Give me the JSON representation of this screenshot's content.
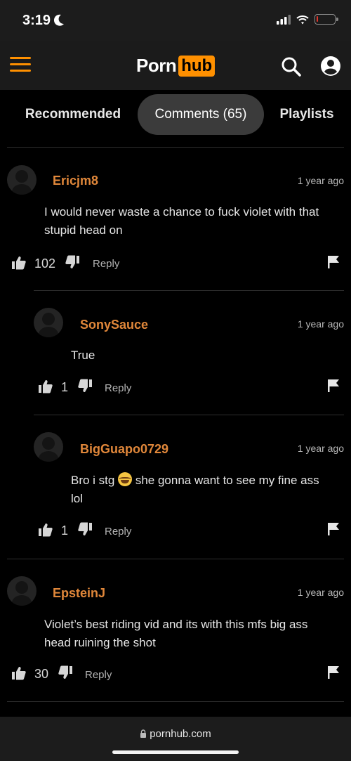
{
  "status_bar": {
    "time": "3:19",
    "battery_level": 0.1,
    "battery_color": "#e0362c"
  },
  "header": {
    "logo_left": "Porn",
    "logo_right": "hub",
    "accent": "#ff9000",
    "icons": [
      "menu-icon",
      "search-icon",
      "account-icon"
    ]
  },
  "tabs": [
    {
      "label": "Recommended",
      "active": false
    },
    {
      "label": "Comments (65)",
      "active": true
    },
    {
      "label": "Playlists",
      "active": false
    }
  ],
  "comments": [
    {
      "username": "Ericjm8",
      "time": "1 year ago",
      "text_line1": "I would never waste a chance to fuck violet with that",
      "text_line2": "stupid head on",
      "likes": "102",
      "reply_label": "Reply"
    },
    {
      "username": "SonySauce",
      "time": "1 year ago",
      "text_line1": "True",
      "likes": "1",
      "reply_label": "Reply"
    },
    {
      "username": "BigGuapo0729",
      "time": "1 year ago",
      "text_before_emoji": "Bro i stg",
      "emoji": "face-with-tears-of-joy",
      "text_after_emoji": "she gonna want to see my fine ass",
      "text_line2": "lol",
      "likes": "1",
      "reply_label": "Reply"
    },
    {
      "username": "EpsteinJ",
      "time": "1 year ago",
      "text_line1": "Violet’s best riding vid and its with this mfs big ass",
      "text_line2": "head ruining the shot",
      "likes": "30",
      "reply_label": "Reply"
    }
  ],
  "colors": {
    "username": "#e0873a",
    "background": "#000000",
    "active_tab_bg": "#3b3b3b"
  },
  "browser": {
    "url": "pornhub.com"
  }
}
